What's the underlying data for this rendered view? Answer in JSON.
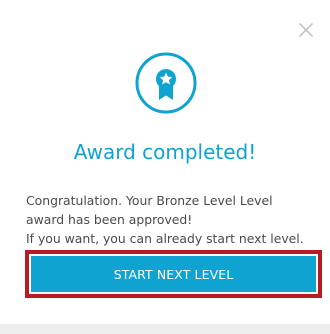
{
  "dialog": {
    "title": "Award completed!",
    "message_lines": [
      "Congratulation. Your Bronze Level Level",
      "award has been approved!",
      "If you want, you can already start next level."
    ],
    "cta_label": "START NEXT LEVEL"
  },
  "icons": {
    "close": "close-icon",
    "award": "award-ribbon-icon"
  },
  "colors": {
    "accent": "#0fa3d2",
    "highlight_border": "#b81b25",
    "text": "#4a4a4a",
    "close_icon": "#c4c4c4"
  }
}
